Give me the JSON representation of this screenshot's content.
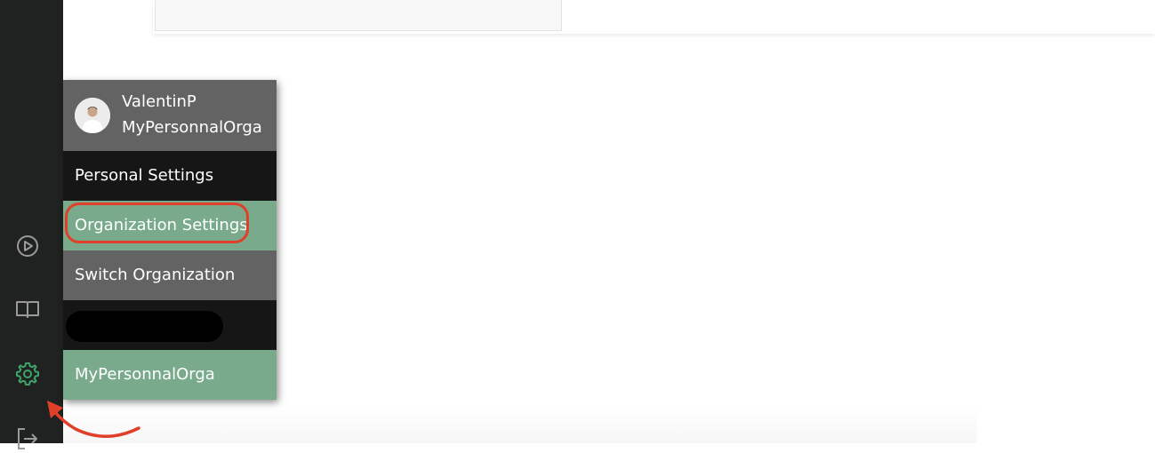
{
  "sidebar": {
    "icons": [
      "play-circle-icon",
      "book-icon",
      "gear-icon",
      "logout-icon"
    ],
    "active_color": "#3fa36a",
    "icon_color": "#9a9a9a"
  },
  "user_menu": {
    "username": "ValentinP",
    "organization": "MyPersonnalOrga",
    "items": [
      {
        "label": "Personal Settings",
        "color": "#161616"
      },
      {
        "label": "Organization Settings",
        "color": "#78aa8b"
      },
      {
        "label": "Switch Organization",
        "color": "#636363"
      }
    ],
    "org_list": [
      {
        "label": "MyPersonnalOrga",
        "color": "#78aa8b"
      }
    ]
  },
  "annotations": {
    "highlight_color": "#e0402a"
  }
}
